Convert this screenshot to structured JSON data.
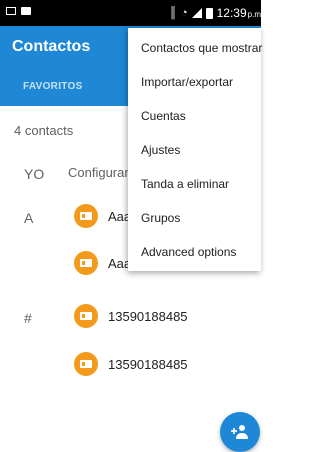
{
  "status_bar": {
    "time": "12:39",
    "time_suffix": "p.m",
    "icons": [
      "screenshot-icon",
      "briefcase-icon",
      "vibrate-icon",
      "wifi-icon",
      "signal-icon",
      "battery-icon"
    ]
  },
  "app_bar": {
    "title": "Contactos",
    "tab_favoritos": "FAVORITOS",
    "color": "#1e88d6"
  },
  "contacts": {
    "count_text": "4 contacts",
    "me": {
      "letter": "YO",
      "label": "Configurar"
    },
    "groups": [
      {
        "letter": "A",
        "rows": [
          "Aaa",
          "Aaa"
        ]
      },
      {
        "letter": "#",
        "rows": [
          "13590188485",
          "13590188485"
        ]
      }
    ],
    "avatar_color": "#f39a1c"
  },
  "overflow_menu": {
    "items": [
      "Contactos que mostrar",
      "Importar/exportar",
      "Cuentas",
      "Ajustes",
      "Tanda a eliminar",
      "Grupos",
      "Advanced options"
    ]
  },
  "fab": {
    "icon": "add-person-icon"
  }
}
